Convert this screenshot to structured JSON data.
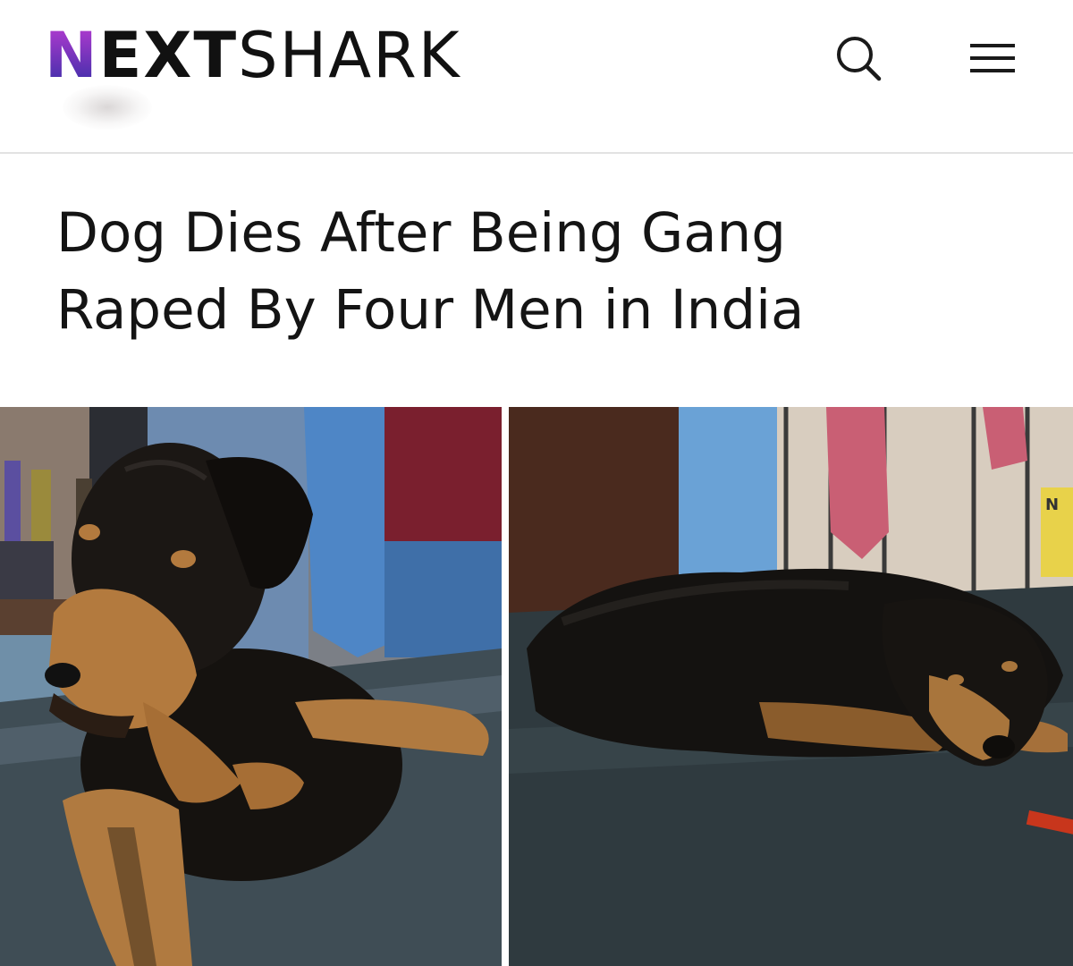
{
  "site": {
    "logo_first": "N",
    "logo_bold": "EXT",
    "logo_rest": "SHARK",
    "brand_gradient": [
      "#b43bd0",
      "#3b2ea8"
    ]
  },
  "header": {
    "search_icon": "search-icon",
    "menu_icon": "hamburger-menu-icon"
  },
  "article": {
    "headline_line1": "Dog Dies After Being Gang",
    "headline_line2": "Raped By Four Men in India",
    "images": [
      {
        "description_icon": "dog-sitting-photo"
      },
      {
        "description_icon": "dog-lying-photo"
      }
    ],
    "sign_fragment": "N"
  }
}
